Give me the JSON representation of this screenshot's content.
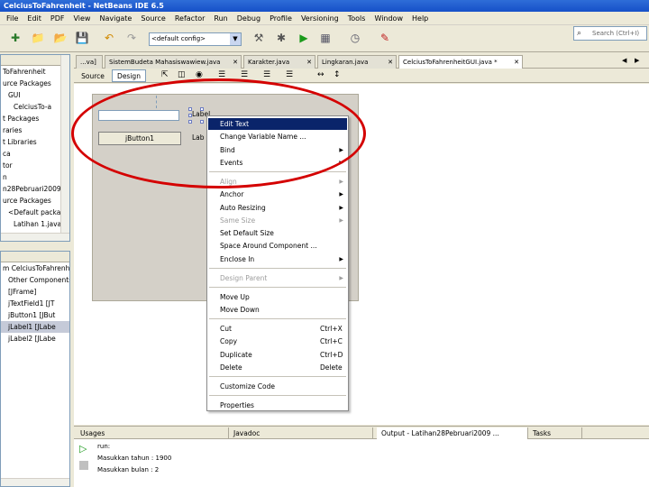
{
  "window": {
    "title": "CelciusToFahrenheit - NetBeans IDE 6.5"
  },
  "menu": [
    "File",
    "Edit",
    "PDF",
    "View",
    "Navigate",
    "Source",
    "Refactor",
    "Run",
    "Debug",
    "Profile",
    "Versioning",
    "Tools",
    "Window",
    "Help"
  ],
  "toolbar": {
    "config_value": "<default config>",
    "search_placeholder": "Search (Ctrl+I)"
  },
  "left_top": {
    "items": [
      "ToFahrenheit",
      "urce Packages",
      "GUI",
      "CelciusTo-a",
      "t Packages",
      "raries",
      "t Libraries",
      "ca",
      "tor",
      "n",
      "n28Pebruari2009",
      "urce Packages",
      "<Default packa",
      "Latihan 1.java"
    ]
  },
  "left_bottom": {
    "items": [
      "m CelciusToFahrenh",
      "Other Components",
      "[JFrame]",
      "jTextField1 [JT",
      "jButton1 [JBut",
      "jLabel1 [JLabe",
      "jLabel2 [JLabe"
    ]
  },
  "editor_tabs": [
    {
      "label": "...va]"
    },
    {
      "label": "SistemBudeta Mahasiswawiew.java"
    },
    {
      "label": "Karakter.java"
    },
    {
      "label": "Lingkaran.java"
    },
    {
      "label": "CelciusToFahrenheitGUI.java *"
    }
  ],
  "design_bar": {
    "source_label": "Source",
    "design_label": "Design"
  },
  "form": {
    "button_label": "jButton1",
    "label1": "Label",
    "label2": "Lab"
  },
  "context_menu": {
    "items": [
      {
        "label": "Edit Text",
        "state": "highlighted"
      },
      {
        "label": "Change Variable Name ...",
        "state": "normal"
      },
      {
        "label": "Bind",
        "state": "normal",
        "submenu": true
      },
      {
        "label": "Events",
        "state": "normal",
        "submenu": true
      },
      {
        "label": "Align",
        "state": "disabled",
        "submenu": true
      },
      {
        "label": "Anchor",
        "state": "normal",
        "submenu": true
      },
      {
        "label": "Auto Resizing",
        "state": "normal",
        "submenu": true
      },
      {
        "label": "Same Size",
        "state": "disabled",
        "submenu": true
      },
      {
        "label": "Set Default Size",
        "state": "normal"
      },
      {
        "label": "Space Around Component ...",
        "state": "normal"
      },
      {
        "label": "Enclose In",
        "state": "normal",
        "submenu": true
      },
      {
        "label": "Design Parent",
        "state": "disabled",
        "submenu": true
      },
      {
        "label": "Move Up",
        "state": "normal"
      },
      {
        "label": "Move Down",
        "state": "normal"
      },
      {
        "label": "Cut",
        "state": "normal",
        "shortcut": "Ctrl+X"
      },
      {
        "label": "Copy",
        "state": "normal",
        "shortcut": "Ctrl+C"
      },
      {
        "label": "Duplicate",
        "state": "normal",
        "shortcut": "Ctrl+D"
      },
      {
        "label": "Delete",
        "state": "normal",
        "shortcut": "Delete"
      },
      {
        "label": "Customize Code",
        "state": "normal"
      },
      {
        "label": "Properties",
        "state": "normal"
      }
    ]
  },
  "bottom_tabs": [
    "Usages",
    "Javadoc",
    "Output - Latihan28Pebruari2009 ...",
    "Tasks"
  ],
  "output_lines": [
    "run:",
    "Masukkan tahun : 1900",
    "Masukkan bulan : 2"
  ],
  "colors": {
    "highlight": "#0a246a",
    "annotation": "#d40000",
    "titlebar": "#1650c8"
  }
}
